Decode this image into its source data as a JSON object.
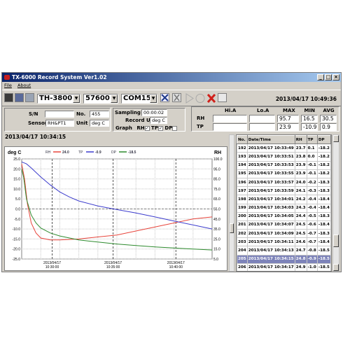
{
  "window": {
    "title": "TX-6000 Record System  Ver1.02"
  },
  "menu": {
    "file": "File",
    "about": "About"
  },
  "toolbar": {
    "model": "TH-3800",
    "baud": "57600",
    "port": "COM15",
    "datetime": "2013/04/17  10:49:36"
  },
  "device": {
    "sn_label": "S/N",
    "sn_value": "",
    "no_label": "No.",
    "no_value": "455",
    "sensor_label": "Sensor",
    "sensor_value": "RH&PT1",
    "unit_label": "Unit",
    "unit_value": "deg C",
    "timestamp": "2013/04/17 10:34:15"
  },
  "settings": {
    "sampling_label": "Sampling",
    "sampling_value": "00:00:02",
    "record_unit_label": "Record Unit",
    "record_unit_value": "deg C",
    "graph_label": "Graph",
    "rh": "RH",
    "tp": "TP",
    "dp": "DP"
  },
  "stats": {
    "headers": [
      "Hi.A",
      "Lo.A",
      "MAX",
      "MIN",
      "AVG"
    ],
    "rows": [
      {
        "label": "RH",
        "values": [
          "",
          "",
          "95.7",
          "16.5",
          "30.5"
        ]
      },
      {
        "label": "TP",
        "values": [
          "",
          "",
          "23.9",
          "-10.9",
          "0.9"
        ]
      }
    ]
  },
  "table": {
    "headers": [
      "No.",
      "Date/Time",
      "RH",
      "TP",
      "DP"
    ],
    "selected_no": "205",
    "rows": [
      [
        "192",
        "2013/04/17 10:33:49",
        "23.7",
        "0.1",
        "-18.2"
      ],
      [
        "193",
        "2013/04/17 10:33:51",
        "23.8",
        "0.0",
        "-18.2"
      ],
      [
        "194",
        "2013/04/17 10:33:53",
        "23.9",
        "-0.1",
        "-18.2"
      ],
      [
        "195",
        "2013/04/17 10:33:55",
        "23.9",
        "-0.1",
        "-18.2"
      ],
      [
        "196",
        "2013/04/17 10:33:57",
        "24.0",
        "-0.2",
        "-18.3"
      ],
      [
        "197",
        "2013/04/17 10:33:59",
        "24.1",
        "-0.3",
        "-18.3"
      ],
      [
        "198",
        "2013/04/17 10:34:01",
        "24.2",
        "-0.4",
        "-18.4"
      ],
      [
        "199",
        "2013/04/17 10:34:03",
        "24.3",
        "-0.4",
        "-18.4"
      ],
      [
        "200",
        "2013/04/17 10:34:05",
        "24.4",
        "-0.5",
        "-18.3"
      ],
      [
        "201",
        "2013/04/17 10:34:07",
        "24.5",
        "-0.6",
        "-18.4"
      ],
      [
        "202",
        "2013/04/17 10:34:09",
        "24.5",
        "-0.7",
        "-18.3"
      ],
      [
        "203",
        "2013/04/17 10:34:11",
        "24.6",
        "-0.7",
        "-18.4"
      ],
      [
        "204",
        "2013/04/17 10:34:13",
        "24.7",
        "-0.8",
        "-18.5"
      ],
      [
        "205",
        "2013/04/17 10:34:15",
        "24.8",
        "-0.9",
        "-18.5"
      ],
      [
        "206",
        "2013/04/17 10:34:17",
        "24.9",
        "-1.0",
        "-18.5"
      ]
    ]
  },
  "colors": {
    "rh": "#e8453c",
    "tp": "#3c3ccd",
    "dp": "#2e8b2e",
    "selected": "#7d83b9",
    "title_bar": "#0a246a"
  },
  "chart_data": {
    "type": "line",
    "left_axis_title": "deg C",
    "right_axis_title": "RH",
    "legend": [
      {
        "name": "RH",
        "value": "24.0"
      },
      {
        "name": "TP",
        "value": "-0.9"
      },
      {
        "name": "DP",
        "value": "-18.5"
      }
    ],
    "left_ylim": [
      -25,
      25
    ],
    "left_ticks": [
      "25.0",
      "20.0",
      "15.0",
      "10.0",
      "5.0",
      "0.0",
      "-5.0",
      "-10.0",
      "-15.0",
      "-20.0",
      "-25.0"
    ],
    "right_ylim": [
      0,
      100
    ],
    "right_ticks": [
      "100.0",
      "95.0",
      "85.0",
      "75.0",
      "65.0",
      "55.0",
      "45.0",
      "35.0",
      "25.0",
      "15.0",
      "5.0"
    ],
    "x_ticks": [
      {
        "date": "2013/04/17",
        "time": "10:30:00"
      },
      {
        "date": "2013/04/17",
        "time": "10:35:00"
      },
      {
        "date": "2013/04/17",
        "time": "10:40:00"
      }
    ],
    "grid": true,
    "series": [
      {
        "name": "RH",
        "axis": "right",
        "x_minutes": [
          0,
          0.3,
          0.6,
          1.0,
          1.5,
          2.0,
          3.0,
          4.0,
          6.0,
          8.0,
          10.0,
          12.0,
          14.0,
          16.0,
          18.0,
          20.0
        ],
        "values": [
          95.0,
          80.0,
          55.0,
          36.0,
          26.0,
          21.0,
          19.0,
          19.0,
          20.0,
          22.0,
          24.0,
          28.0,
          32.0,
          36.0,
          40.0,
          42.0
        ]
      },
      {
        "name": "TP",
        "axis": "left",
        "x_minutes": [
          0,
          0.5,
          1.0,
          2.0,
          3.0,
          4.0,
          5.0,
          6.0,
          8.0,
          10.0,
          12.0,
          14.0,
          16.0,
          18.0,
          20.0
        ],
        "values": [
          23.5,
          22.5,
          20.5,
          16.0,
          12.0,
          8.5,
          6.0,
          4.0,
          1.5,
          -0.3,
          -2.0,
          -4.0,
          -6.0,
          -8.0,
          -10.0
        ]
      },
      {
        "name": "DP",
        "axis": "left",
        "x_minutes": [
          0,
          0.2,
          0.5,
          1.0,
          1.5,
          2.0,
          3.0,
          4.0,
          6.0,
          8.0,
          10.0,
          12.0,
          14.0,
          16.0,
          18.0,
          20.0
        ],
        "values": [
          20.0,
          16.0,
          5.0,
          -3.0,
          -7.0,
          -9.5,
          -12.0,
          -13.5,
          -15.5,
          -16.5,
          -17.5,
          -18.3,
          -19.0,
          -19.5,
          -20.0,
          -20.5
        ]
      }
    ]
  }
}
